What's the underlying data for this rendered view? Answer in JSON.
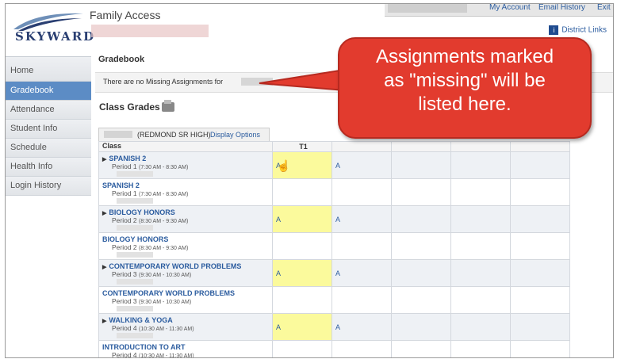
{
  "header": {
    "logo_text": "SKYWARD",
    "app_title": "Family Access",
    "topnav": [
      "My Account",
      "Email History",
      "Exit"
    ],
    "district_links": "District Links",
    "district_icon": "i"
  },
  "sidebar": {
    "items": [
      {
        "label": "Home"
      },
      {
        "label": "Gradebook",
        "active": true
      },
      {
        "label": "Attendance"
      },
      {
        "label": "Student Info"
      },
      {
        "label": "Schedule"
      },
      {
        "label": "Health Info"
      },
      {
        "label": "Login History"
      }
    ]
  },
  "main": {
    "gradebook_title": "Gradebook",
    "missing_text": "There are no Missing Assignments for",
    "class_grades_title": "Class Grades",
    "school": "(REDMOND SR HIGH)",
    "display_options": "Display Options",
    "col_class": "Class",
    "col_t1": "T1",
    "rows": [
      {
        "name": "SPANISH 2",
        "period": "Period 1",
        "time": "(7:30 AM - 8:30 AM)",
        "expandable": true,
        "t1": "A",
        "col3": "A"
      },
      {
        "name": "SPANISH 2",
        "period": "Period 1",
        "time": "(7:30 AM - 8:30 AM)",
        "expandable": false,
        "t1": "",
        "col3": ""
      },
      {
        "name": "BIOLOGY HONORS",
        "period": "Period 2",
        "time": "(8:30 AM - 9:30 AM)",
        "expandable": true,
        "t1": "A",
        "col3": "A"
      },
      {
        "name": "BIOLOGY HONORS",
        "period": "Period 2",
        "time": "(8:30 AM - 9:30 AM)",
        "expandable": false,
        "t1": "",
        "col3": ""
      },
      {
        "name": "CONTEMPORARY WORLD PROBLEMS",
        "period": "Period 3",
        "time": "(9:30 AM - 10:30 AM)",
        "expandable": true,
        "t1": "A",
        "col3": "A"
      },
      {
        "name": "CONTEMPORARY WORLD PROBLEMS",
        "period": "Period 3",
        "time": "(9:30 AM - 10:30 AM)",
        "expandable": false,
        "t1": "",
        "col3": ""
      },
      {
        "name": "WALKING & YOGA",
        "period": "Period 4",
        "time": "(10:30 AM - 11:30 AM)",
        "expandable": true,
        "t1": "A",
        "col3": "A"
      },
      {
        "name": "INTRODUCTION TO ART",
        "period": "Period 4",
        "time": "(10:30 AM - 11:30 AM)",
        "expandable": false,
        "t1": "",
        "col3": ""
      }
    ]
  },
  "callout": {
    "lines": [
      "Assignments marked",
      "as \"missing\" will be",
      "listed here."
    ]
  },
  "colors": {
    "accent": "#5c8cc5",
    "link": "#2b5c9f",
    "callout": "#e23b2e",
    "highlight": "#fbfa9c"
  }
}
